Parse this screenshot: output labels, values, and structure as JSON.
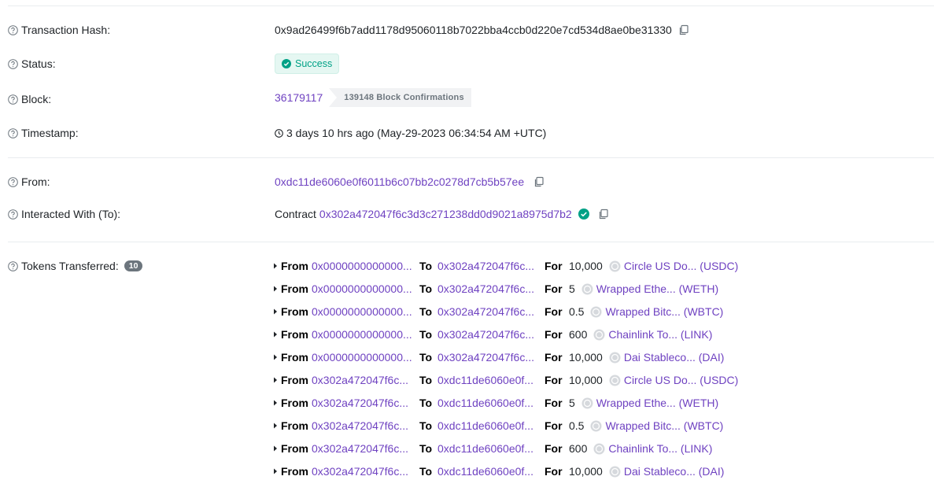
{
  "tx_hash": {
    "label": "Transaction Hash:",
    "value": "0x9ad26499f6b7add1178d95060118b7022bba4ccb0d220e7cd534d8ae0be31330"
  },
  "status": {
    "label": "Status:",
    "value": "Success"
  },
  "block": {
    "label": "Block:",
    "number": "36179117",
    "confirmations": "139148 Block Confirmations"
  },
  "timestamp": {
    "label": "Timestamp:",
    "value": "3 days 10 hrs ago (May-29-2023 06:34:54 AM +UTC)"
  },
  "from": {
    "label": "From:",
    "value": "0xdc11de6060e0f6011b6c07bb2c0278d7cb5b57ee"
  },
  "interacted": {
    "label": "Interacted With (To):",
    "prefix": "Contract",
    "value": "0x302a472047f6c3d3c271238dd0d9021a8975d7b2"
  },
  "tokens": {
    "label": "Tokens Transferred:",
    "count": "10",
    "from_label": "From",
    "to_label": "To",
    "for_label": "For",
    "transfers": [
      {
        "from": "0x0000000000000...",
        "to": "0x302a472047f6c...",
        "amount": "10,000",
        "token": "Circle US Do... (USDC)"
      },
      {
        "from": "0x0000000000000...",
        "to": "0x302a472047f6c...",
        "amount": "5",
        "token": "Wrapped Ethe... (WETH)"
      },
      {
        "from": "0x0000000000000...",
        "to": "0x302a472047f6c...",
        "amount": "0.5",
        "token": "Wrapped Bitc... (WBTC)"
      },
      {
        "from": "0x0000000000000...",
        "to": "0x302a472047f6c...",
        "amount": "600",
        "token": "Chainlink To... (LINK)"
      },
      {
        "from": "0x0000000000000...",
        "to": "0x302a472047f6c...",
        "amount": "10,000",
        "token": "Dai Stableco... (DAI)"
      },
      {
        "from": "0x302a472047f6c...",
        "to": "0xdc11de6060e0f...",
        "amount": "10,000",
        "token": "Circle US Do... (USDC)"
      },
      {
        "from": "0x302a472047f6c...",
        "to": "0xdc11de6060e0f...",
        "amount": "5",
        "token": "Wrapped Ethe... (WETH)"
      },
      {
        "from": "0x302a472047f6c...",
        "to": "0xdc11de6060e0f...",
        "amount": "0.5",
        "token": "Wrapped Bitc... (WBTC)"
      },
      {
        "from": "0x302a472047f6c...",
        "to": "0xdc11de6060e0f...",
        "amount": "600",
        "token": "Chainlink To... (LINK)"
      },
      {
        "from": "0x302a472047f6c...",
        "to": "0xdc11de6060e0f...",
        "amount": "10,000",
        "token": "Dai Stableco... (DAI)"
      }
    ]
  },
  "colors": {
    "link": "#6f42c1",
    "success": "#00a186",
    "muted": "#6c757d"
  },
  "icons": [
    "question-circle-icon",
    "copy-icon",
    "check-circle-icon",
    "clock-icon",
    "verified-icon",
    "caret-right-icon",
    "token-icon"
  ]
}
